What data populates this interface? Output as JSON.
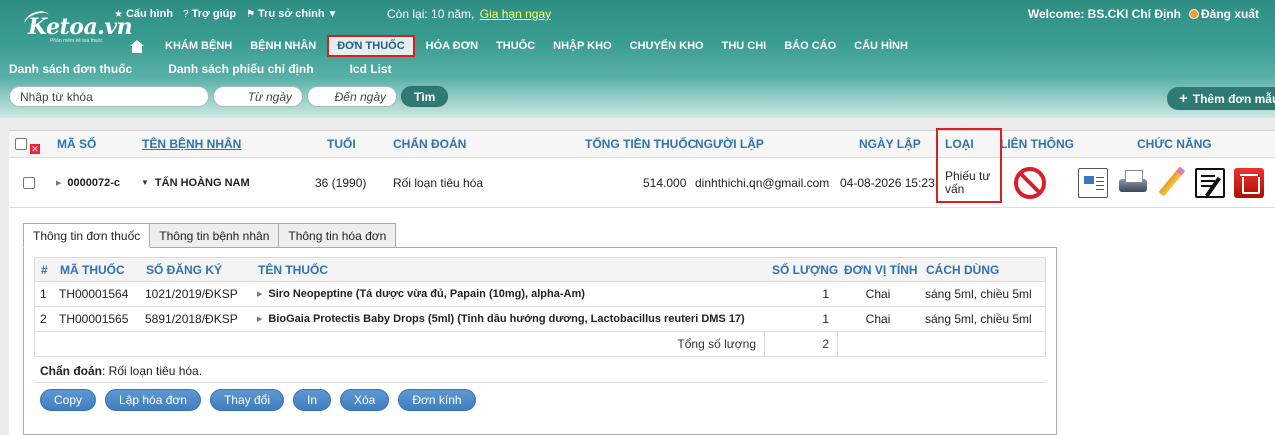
{
  "brand": {
    "logo_text": "Ketoa.vn",
    "tagline": "Phần mềm kê toa thuốc"
  },
  "topbar": {
    "links": [
      {
        "label": "Cấu hình",
        "icon": "star-icon",
        "glyph": "★"
      },
      {
        "label": "Trợ giúp",
        "icon": "help-icon",
        "glyph": "?"
      },
      {
        "label": "Trụ sở chính",
        "icon": "pin-icon",
        "glyph": "⚑",
        "dropdown": "▼"
      }
    ],
    "remaining_label": "Còn lại: 10 năm,",
    "renew_link": "Gia hạn ngay",
    "welcome": "Welcome: BS.CKI Chí Định",
    "logout": "Đăng xuất"
  },
  "nav": {
    "items": [
      "KHÁM BỆNH",
      "BỆNH NHÂN",
      "ĐƠN THUỐC",
      "HÓA ĐƠN",
      "THUỐC",
      "NHẬP KHO",
      "CHUYỂN KHO",
      "THU CHI",
      "BÁO CÁO",
      "CẤU HÌNH"
    ],
    "active": "ĐƠN THUỐC"
  },
  "subnav": [
    "Danh sách đơn thuốc",
    "Danh sách phiếu chỉ định",
    "Icd List"
  ],
  "search": {
    "keyword_placeholder": "Nhập từ khóa",
    "from_placeholder": "Từ ngày",
    "to_placeholder": "Đến ngày",
    "button": "Tìm"
  },
  "add_button": "Thêm đơn mẫu",
  "list": {
    "headers": {
      "code": "MÃ SỐ",
      "patient": "TÊN BỆNH NHÂN",
      "age": "TUỔI",
      "diagnosis": "CHẨN ĐOÁN",
      "total": "TỔNG TIỀN THUỐC",
      "creator": "NGƯỜI LẬP",
      "date": "NGÀY LẬP",
      "type": "LOẠI",
      "link": "LIÊN THÔNG",
      "functions": "CHỨC NĂNG"
    },
    "rows": [
      {
        "code": "0000072-c",
        "patient": "TẤN HOÀNG NAM",
        "age": "36 (1990)",
        "diagnosis": "Rối loạn tiêu hóa",
        "total": "514.000",
        "creator": "dinhthichi.qn@gmail.com",
        "date": "04-08-2026 15:23",
        "type": "Phiếu tư vấn"
      }
    ]
  },
  "detail": {
    "tabs": [
      "Thông tin đơn thuốc",
      "Thông tin bệnh nhân",
      "Thông tin hóa đơn"
    ],
    "active_tab": 0,
    "headers": {
      "idx": "#",
      "code": "MÃ THUỐC",
      "reg": "SỐ ĐĂNG KÝ",
      "name": "TÊN THUỐC",
      "qty": "SỐ LƯỢNG",
      "unit": "ĐƠN VỊ TÍNH",
      "usage": "CÁCH DÙNG"
    },
    "items": [
      {
        "idx": "1",
        "code": "TH00001564",
        "reg": "1021/2019/ĐKSP",
        "name": "Siro Neopeptine (Tá dược vừa đủ, Papain (10mg), alpha-Am)",
        "qty": "1",
        "unit": "Chai",
        "usage": "sáng 5ml, chiều 5ml"
      },
      {
        "idx": "2",
        "code": "TH00001565",
        "reg": "5891/2018/ĐKSP",
        "name": "BioGaia Protectis Baby Drops (5ml) (Tinh dầu hướng dương, Lactobacillus reuteri DMS 17)",
        "qty": "1",
        "unit": "Chai",
        "usage": "sáng 5ml, chiều 5ml"
      }
    ],
    "total_label": "Tổng số lượng",
    "total_qty": "2",
    "diagnosis_label": "Chẩn đoán",
    "diagnosis_value": ": Rối loạn tiêu hóa.",
    "actions": [
      "Copy",
      "Lập hóa đơn",
      "Thay đổi",
      "In",
      "Xóa",
      "Đơn kính"
    ]
  },
  "colors": {
    "header_teal": "#2f8e83",
    "accent_blue": "#2d73b4",
    "highlight_red": "#d92020",
    "button_blue": "#4a87c5"
  }
}
